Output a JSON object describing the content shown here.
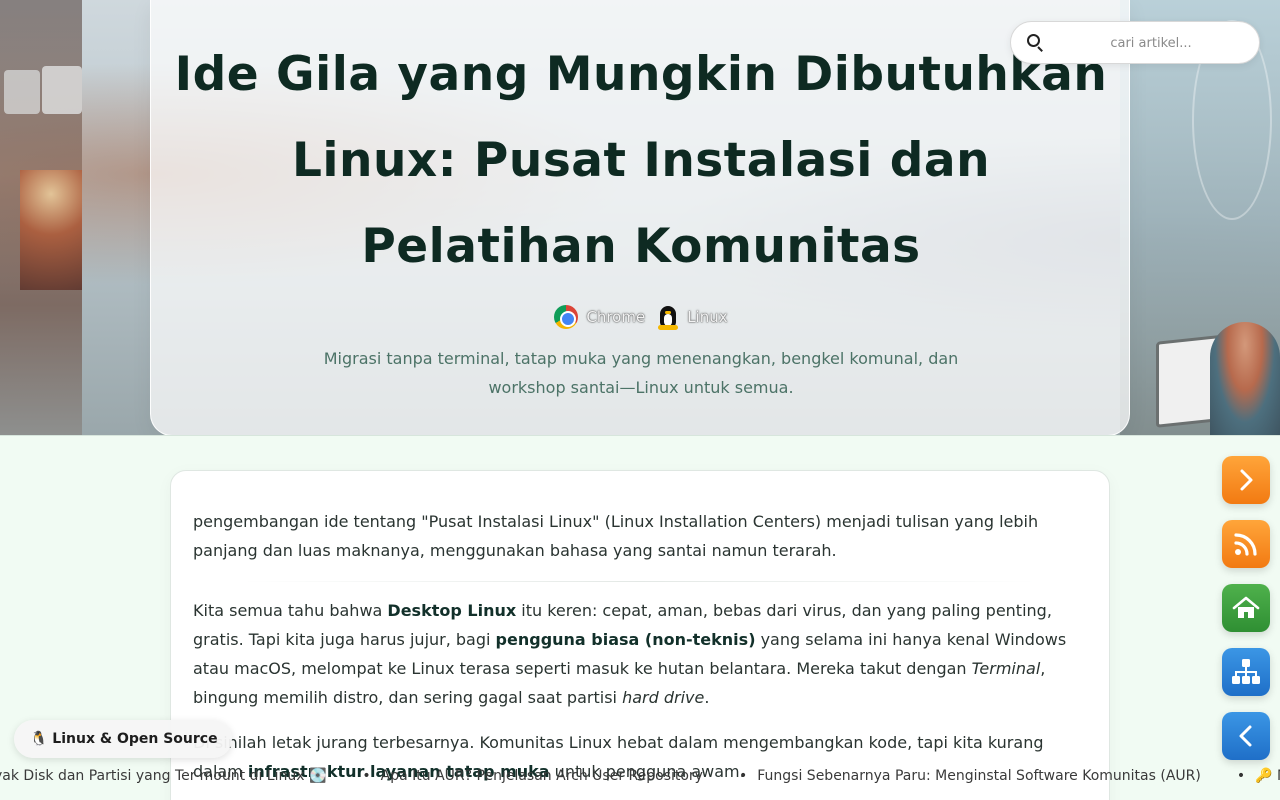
{
  "hero": {
    "title": "Ide Gila yang Mungkin Dibutuhkan Linux: Pusat Instalasi dan Pelatihan Komunitas",
    "tags": [
      {
        "label": "Chrome",
        "icon": "chrome-icon"
      },
      {
        "label": "Linux",
        "icon": "tux-icon"
      }
    ],
    "subtitle": "Migrasi tanpa terminal, tatap muka yang menenangkan, bengkel komunal, dan workshop santai—Linux untuk semua."
  },
  "search": {
    "placeholder": "cari artikel...",
    "value": ""
  },
  "article": {
    "p1": " pengembangan ide tentang \"Pusat Instalasi Linux\" (Linux Installation Centers) menjadi tulisan yang lebih panjang dan luas maknanya, menggunakan bahasa yang santai namun terarah.",
    "p2_a": "Kita semua tahu bahwa ",
    "p2_b": "Desktop Linux",
    "p2_c": " itu keren: cepat, aman, bebas dari virus, dan yang paling penting, gratis. Tapi kita juga harus jujur, bagi ",
    "p2_d": "pengguna biasa (non-teknis)",
    "p2_e": " yang selama ini hanya kenal Windows atau macOS, melompat ke Linux terasa seperti masuk ke hutan belantara. Mereka takut dengan ",
    "p2_f": "Terminal",
    "p2_g": ", bingung memilih distro, dan sering gagal saat partisi ",
    "p2_h": "hard drive",
    "p2_i": ".",
    "p3_a": "Di sinilah letak jurang terbesarnya. Komunitas Linux hebat dalam mengembangkan kode, tapi kita kurang dalam ",
    "p3_b": "infrastruktur layanan tatap muka",
    "p3_c": " untuk pengguna awam."
  },
  "badge": {
    "icon": "tux-emoji",
    "label": "🐧 Linux & Open Source"
  },
  "side_buttons": [
    {
      "name": "next-button",
      "icon": "chevron-right-icon",
      "color": "#f58a1f"
    },
    {
      "name": "rss-button",
      "icon": "rss-icon",
      "color": "#f58a1f"
    },
    {
      "name": "home-button",
      "icon": "home-icon",
      "color": "#3aa03d"
    },
    {
      "name": "sitemap-button",
      "icon": "sitemap-icon",
      "color": "#2b82d9"
    },
    {
      "name": "prev-button",
      "icon": "chevron-left-icon",
      "color": "#2b82d9"
    }
  ],
  "ticker": [
    "yak Disk dan Partisi yang Ter-mount di Linux 💽",
    "Apa Itu AUR? Penjelasan Arch User Repository",
    "Fungsi Sebenarnya Paru: Menginstal Software Komunitas (AUR)",
    "🔑 Mempe"
  ]
}
